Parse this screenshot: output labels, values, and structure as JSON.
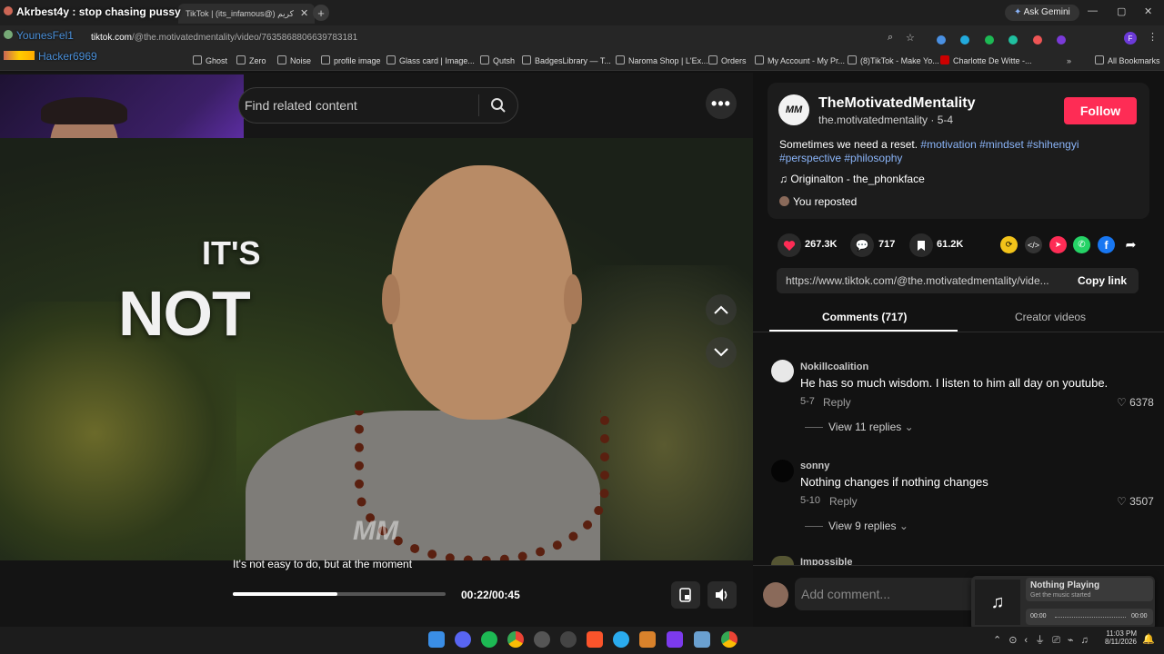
{
  "overlay": {
    "chat_line_1": "Akrbest4y : stop chasing pussy",
    "chat_user_2": "YounesFel1",
    "chat_user_3": "Hacker6969"
  },
  "browser": {
    "tab_title": "TikTok | (its_infamous@) كريم",
    "url_host": "tiktok.com",
    "url_path": "/@the.motivatedmentality/video/7635868806639783181",
    "ask_gemini": "Ask Gemini",
    "bookmarks": [
      "Ghost",
      "Zero",
      "Noise",
      "profile image",
      "Glass card | Image...",
      "Qutsh",
      "BadgesLibrary — T...",
      "Naroma Shop | L'Ex...",
      "Orders",
      "My Account - My Pr...",
      "(8)TikTok - Make Yo...",
      "Charlotte De Witte -..."
    ],
    "all_bookmarks": "All Bookmarks"
  },
  "search": {
    "placeholder": "Find related content"
  },
  "video": {
    "overlay_line_1": "IT'S",
    "overlay_line_2": "NOT",
    "watermark": "MM",
    "caption": "It's not easy to do, but at the moment",
    "time_current": "00:22",
    "time_total": "00:45",
    "progress": 0.49
  },
  "author": {
    "display_name": "TheMotivatedMentality",
    "handle": "the.motivatedmentality",
    "date": "5-4",
    "follow_label": "Follow",
    "avatar_text": "MM",
    "description": "Sometimes we need a reset.",
    "hashtags_1": "#motivation #mindset #shihengyi",
    "hashtags_2": "#perspective #philosophy",
    "sound": "Originalton - the_phonkface",
    "repost": "You reposted"
  },
  "stats": {
    "likes": "267.3K",
    "comments": "717",
    "saves": "61.2K"
  },
  "share": {
    "link": "https://www.tiktok.com/@the.motivatedmentality/vide...",
    "copy_label": "Copy link"
  },
  "tabs": {
    "comments": "Comments (717)",
    "creator": "Creator videos"
  },
  "comments": [
    {
      "user": "Nokillcoalition",
      "text": "He has so much wisdom. I listen to him all day on youtube.",
      "date": "5-7",
      "reply": "Reply",
      "likes": "6378",
      "replies": "View 11 replies"
    },
    {
      "user": "sonny",
      "text": "Nothing changes if nothing changes",
      "date": "5-10",
      "reply": "Reply",
      "likes": "3507",
      "replies": "View 9 replies"
    },
    {
      "user": "Impossible"
    }
  ],
  "add_comment": {
    "placeholder": "Add comment..."
  },
  "music_widget": {
    "title": "Nothing Playing",
    "subtitle": "Get the music started",
    "time_left": "00:00",
    "time_right": "00:00"
  },
  "taskbar": {
    "time": "11:03 PM",
    "date": "8/11/2026"
  },
  "colors": {
    "accent": "#fe2c55",
    "link": "#8ab4f8"
  }
}
